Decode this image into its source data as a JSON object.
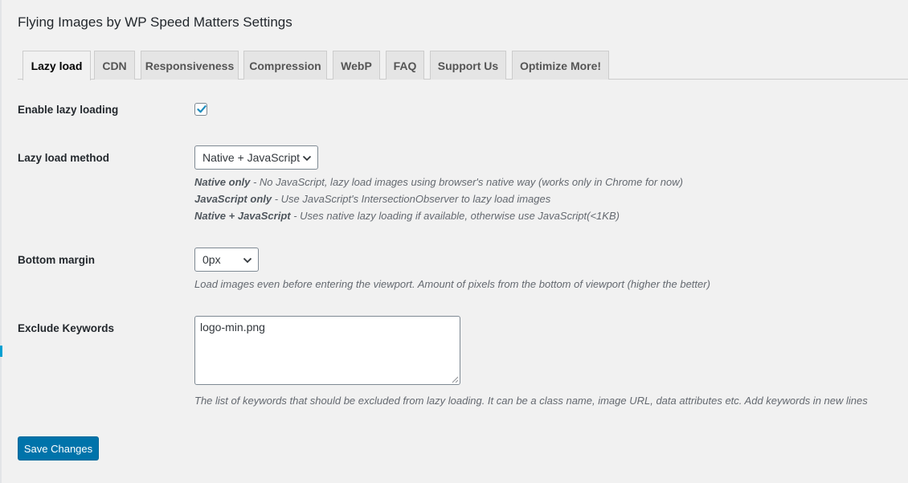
{
  "page": {
    "title": "Flying Images by WP Speed Matters Settings"
  },
  "tabs": [
    {
      "label": "Lazy load",
      "active": true
    },
    {
      "label": "CDN"
    },
    {
      "label": "Responsiveness"
    },
    {
      "label": "Compression"
    },
    {
      "label": "WebP"
    },
    {
      "label": "FAQ"
    },
    {
      "label": "Support Us"
    },
    {
      "label": "Optimize More!"
    }
  ],
  "settings": {
    "enable_lazy": {
      "label": "Enable lazy loading",
      "checked": true
    },
    "method": {
      "label": "Lazy load method",
      "selected": "Native + JavaScript",
      "descriptions": [
        {
          "term": "Native only",
          "text": " - No JavaScript, lazy load images using browser's native way (works only in Chrome for now)"
        },
        {
          "term": "JavaScript only",
          "text": " - Use JavaScript's IntersectionObserver to lazy load images"
        },
        {
          "term": "Native + JavaScript",
          "text": " - Uses native lazy loading if available, otherwise use JavaScript(<1KB)"
        }
      ]
    },
    "bottom_margin": {
      "label": "Bottom margin",
      "selected": "0px",
      "description": "Load images even before entering the viewport. Amount of pixels from the bottom of viewport (higher the better)"
    },
    "exclude": {
      "label": "Exclude Keywords",
      "value": "logo-min.png",
      "description": "The list of keywords that should be excluded from lazy loading. It can be a class name, image URL, data attributes etc. Add keywords in new lines"
    }
  },
  "actions": {
    "save_label": "Save Changes"
  },
  "colors": {
    "primary": "#0073aa",
    "background": "#f1f1f1",
    "checkmark": "#1e8cbe"
  }
}
